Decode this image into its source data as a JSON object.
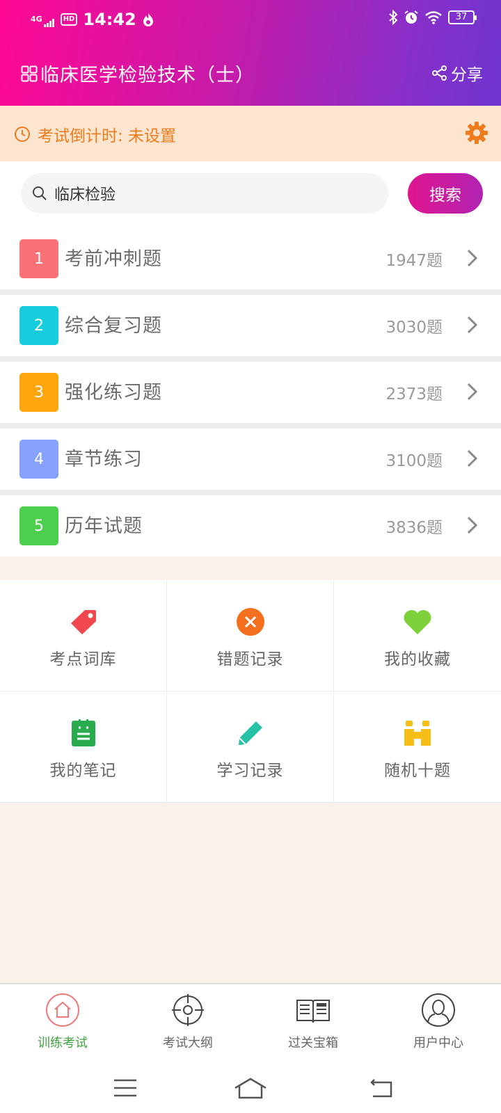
{
  "status_bar": {
    "network": "4G",
    "hd": "HD",
    "time": "14:42",
    "battery": "37"
  },
  "header": {
    "title": "临床医学检验技术（士）",
    "share_label": "分享"
  },
  "countdown": {
    "label": "考试倒计时: 未设置"
  },
  "search": {
    "value": "临床检验",
    "button_label": "搜索"
  },
  "categories": [
    {
      "num": "1",
      "name": "考前冲刺题",
      "count": "1947题",
      "color": "#fb7276"
    },
    {
      "num": "2",
      "name": "综合复习题",
      "count": "3030题",
      "color": "#17cddd"
    },
    {
      "num": "3",
      "name": "强化练习题",
      "count": "2373题",
      "color": "#ffa60d"
    },
    {
      "num": "4",
      "name": "章节练习",
      "count": "3100题",
      "color": "#85a1fc"
    },
    {
      "num": "5",
      "name": "历年试题",
      "count": "3836题",
      "color": "#4ccf4c"
    }
  ],
  "grid": [
    {
      "label": "考点词库",
      "icon": "tag-icon"
    },
    {
      "label": "错题记录",
      "icon": "wrong-x-icon"
    },
    {
      "label": "我的收藏",
      "icon": "heart-icon"
    },
    {
      "label": "我的笔记",
      "icon": "notebook-icon"
    },
    {
      "label": "学习记录",
      "icon": "pencil-icon"
    },
    {
      "label": "随机十题",
      "icon": "binoculars-icon"
    }
  ],
  "tabs": [
    {
      "label": "训练考试",
      "icon": "home-icon",
      "active": true
    },
    {
      "label": "考试大纲",
      "icon": "target-icon",
      "active": false
    },
    {
      "label": "过关宝箱",
      "icon": "news-book-icon",
      "active": false
    },
    {
      "label": "用户中心",
      "icon": "user-icon",
      "active": false
    }
  ],
  "colors": {
    "header_start": "#ff0894",
    "header_end": "#6e34cf",
    "accent_orange": "#ef7c1c",
    "active_tab": "#3fa53f"
  }
}
